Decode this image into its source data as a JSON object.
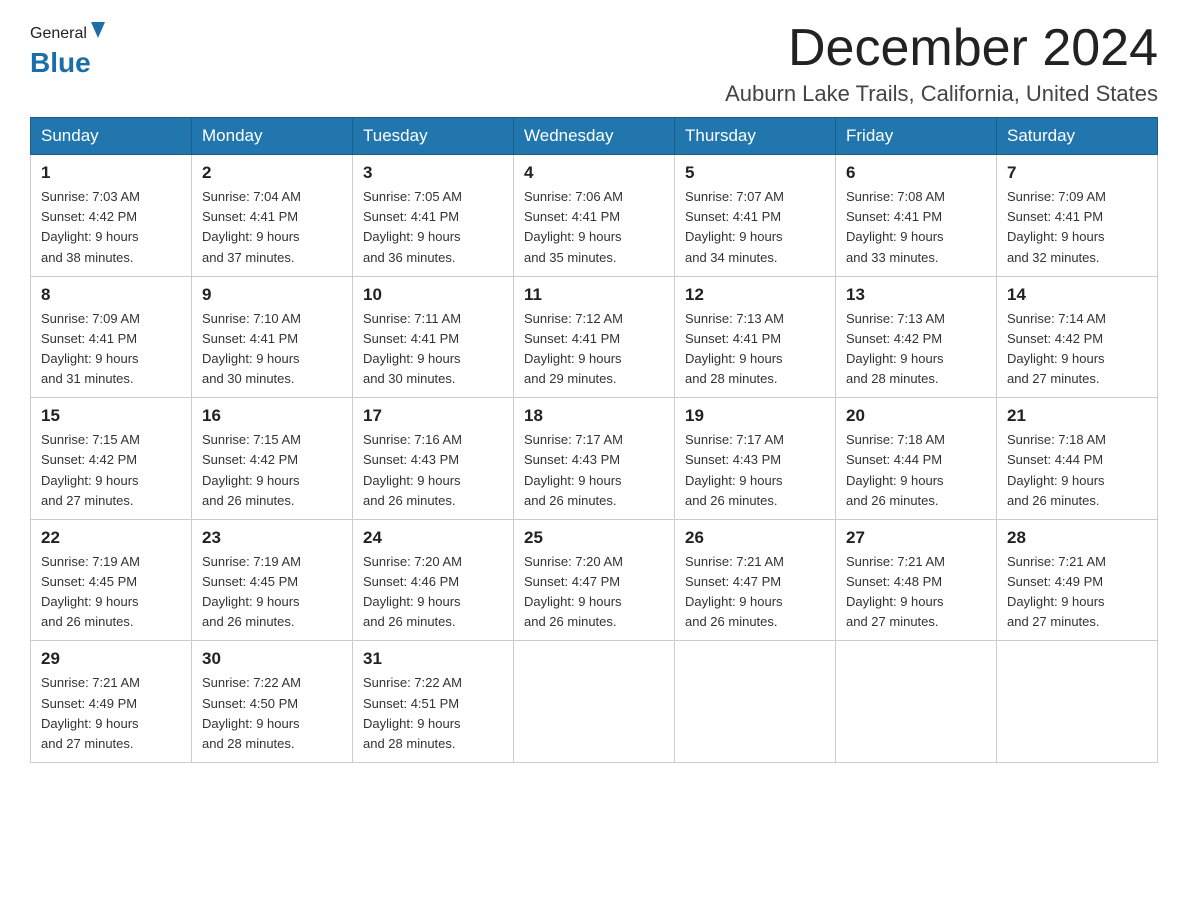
{
  "header": {
    "logo_general": "General",
    "logo_blue": "Blue",
    "month_title": "December 2024",
    "location": "Auburn Lake Trails, California, United States"
  },
  "weekdays": [
    "Sunday",
    "Monday",
    "Tuesday",
    "Wednesday",
    "Thursday",
    "Friday",
    "Saturday"
  ],
  "weeks": [
    [
      {
        "day": "1",
        "sunrise": "7:03 AM",
        "sunset": "4:42 PM",
        "daylight": "9 hours and 38 minutes."
      },
      {
        "day": "2",
        "sunrise": "7:04 AM",
        "sunset": "4:41 PM",
        "daylight": "9 hours and 37 minutes."
      },
      {
        "day": "3",
        "sunrise": "7:05 AM",
        "sunset": "4:41 PM",
        "daylight": "9 hours and 36 minutes."
      },
      {
        "day": "4",
        "sunrise": "7:06 AM",
        "sunset": "4:41 PM",
        "daylight": "9 hours and 35 minutes."
      },
      {
        "day": "5",
        "sunrise": "7:07 AM",
        "sunset": "4:41 PM",
        "daylight": "9 hours and 34 minutes."
      },
      {
        "day": "6",
        "sunrise": "7:08 AM",
        "sunset": "4:41 PM",
        "daylight": "9 hours and 33 minutes."
      },
      {
        "day": "7",
        "sunrise": "7:09 AM",
        "sunset": "4:41 PM",
        "daylight": "9 hours and 32 minutes."
      }
    ],
    [
      {
        "day": "8",
        "sunrise": "7:09 AM",
        "sunset": "4:41 PM",
        "daylight": "9 hours and 31 minutes."
      },
      {
        "day": "9",
        "sunrise": "7:10 AM",
        "sunset": "4:41 PM",
        "daylight": "9 hours and 30 minutes."
      },
      {
        "day": "10",
        "sunrise": "7:11 AM",
        "sunset": "4:41 PM",
        "daylight": "9 hours and 30 minutes."
      },
      {
        "day": "11",
        "sunrise": "7:12 AM",
        "sunset": "4:41 PM",
        "daylight": "9 hours and 29 minutes."
      },
      {
        "day": "12",
        "sunrise": "7:13 AM",
        "sunset": "4:41 PM",
        "daylight": "9 hours and 28 minutes."
      },
      {
        "day": "13",
        "sunrise": "7:13 AM",
        "sunset": "4:42 PM",
        "daylight": "9 hours and 28 minutes."
      },
      {
        "day": "14",
        "sunrise": "7:14 AM",
        "sunset": "4:42 PM",
        "daylight": "9 hours and 27 minutes."
      }
    ],
    [
      {
        "day": "15",
        "sunrise": "7:15 AM",
        "sunset": "4:42 PM",
        "daylight": "9 hours and 27 minutes."
      },
      {
        "day": "16",
        "sunrise": "7:15 AM",
        "sunset": "4:42 PM",
        "daylight": "9 hours and 26 minutes."
      },
      {
        "day": "17",
        "sunrise": "7:16 AM",
        "sunset": "4:43 PM",
        "daylight": "9 hours and 26 minutes."
      },
      {
        "day": "18",
        "sunrise": "7:17 AM",
        "sunset": "4:43 PM",
        "daylight": "9 hours and 26 minutes."
      },
      {
        "day": "19",
        "sunrise": "7:17 AM",
        "sunset": "4:43 PM",
        "daylight": "9 hours and 26 minutes."
      },
      {
        "day": "20",
        "sunrise": "7:18 AM",
        "sunset": "4:44 PM",
        "daylight": "9 hours and 26 minutes."
      },
      {
        "day": "21",
        "sunrise": "7:18 AM",
        "sunset": "4:44 PM",
        "daylight": "9 hours and 26 minutes."
      }
    ],
    [
      {
        "day": "22",
        "sunrise": "7:19 AM",
        "sunset": "4:45 PM",
        "daylight": "9 hours and 26 minutes."
      },
      {
        "day": "23",
        "sunrise": "7:19 AM",
        "sunset": "4:45 PM",
        "daylight": "9 hours and 26 minutes."
      },
      {
        "day": "24",
        "sunrise": "7:20 AM",
        "sunset": "4:46 PM",
        "daylight": "9 hours and 26 minutes."
      },
      {
        "day": "25",
        "sunrise": "7:20 AM",
        "sunset": "4:47 PM",
        "daylight": "9 hours and 26 minutes."
      },
      {
        "day": "26",
        "sunrise": "7:21 AM",
        "sunset": "4:47 PM",
        "daylight": "9 hours and 26 minutes."
      },
      {
        "day": "27",
        "sunrise": "7:21 AM",
        "sunset": "4:48 PM",
        "daylight": "9 hours and 27 minutes."
      },
      {
        "day": "28",
        "sunrise": "7:21 AM",
        "sunset": "4:49 PM",
        "daylight": "9 hours and 27 minutes."
      }
    ],
    [
      {
        "day": "29",
        "sunrise": "7:21 AM",
        "sunset": "4:49 PM",
        "daylight": "9 hours and 27 minutes."
      },
      {
        "day": "30",
        "sunrise": "7:22 AM",
        "sunset": "4:50 PM",
        "daylight": "9 hours and 28 minutes."
      },
      {
        "day": "31",
        "sunrise": "7:22 AM",
        "sunset": "4:51 PM",
        "daylight": "9 hours and 28 minutes."
      },
      null,
      null,
      null,
      null
    ]
  ],
  "labels": {
    "sunrise": "Sunrise:",
    "sunset": "Sunset:",
    "daylight": "Daylight:"
  }
}
